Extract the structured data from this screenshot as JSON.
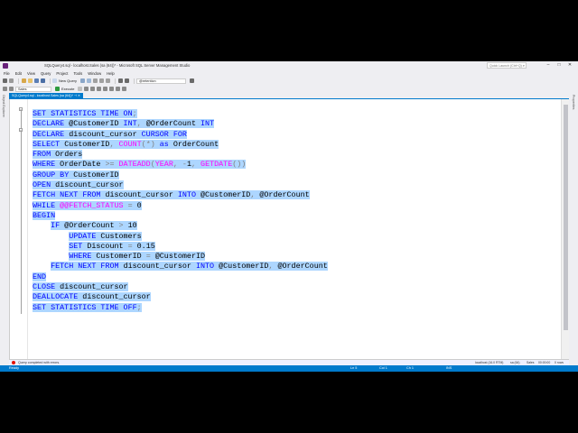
{
  "window": {
    "title": "SQLQuery4.sql - localhost.Sales (sa (64))* - Microsoft SQL Server Management Studio",
    "quick_launch_placeholder": "Quick Launch (Ctrl+Q)"
  },
  "menu": [
    "File",
    "Edit",
    "View",
    "Query",
    "Project",
    "Tools",
    "Window",
    "Help"
  ],
  "toolbar": {
    "new_query_label": "New Query",
    "database_value": "Sales",
    "execute_label": "Execute",
    "search_value": "@retention"
  },
  "side": {
    "left_label": "Object Explorer",
    "right_label": "Properties"
  },
  "tabs": [
    {
      "label": "SQLQuery4.sql - localhost.Sales (sa (64))*",
      "active": true
    }
  ],
  "code": [
    {
      "text": "SET STATISTICS TIME ON;"
    },
    {
      "text": "DECLARE @CustomerID INT, @OrderCount INT"
    },
    {
      "text": "DECLARE discount_cursor CURSOR FOR"
    },
    {
      "text": "SELECT CustomerID, COUNT(*) as OrderCount"
    },
    {
      "text": "FROM Orders"
    },
    {
      "text": "WHERE OrderDate >= DATEADD(YEAR, -1, GETDATE())"
    },
    {
      "text": "GROUP BY CustomerID"
    },
    {
      "text": "OPEN discount_cursor"
    },
    {
      "text": "FETCH NEXT FROM discount_cursor INTO @CustomerID, @OrderCount"
    },
    {
      "text": "WHILE @@FETCH_STATUS = 0"
    },
    {
      "text": "BEGIN"
    },
    {
      "text": "    IF @OrderCount > 10"
    },
    {
      "text": "        UPDATE Customers"
    },
    {
      "text": "        SET Discount = 0.15"
    },
    {
      "text": "        WHERE CustomerID = @CustomerID"
    },
    {
      "text": "    FETCH NEXT FROM discount_cursor INTO @CustomerID, @OrderCount"
    },
    {
      "text": "END"
    },
    {
      "text": "CLOSE discount_cursor"
    },
    {
      "text": "DEALLOCATE discount_cursor"
    },
    {
      "text": "SET STATISTICS TIME OFF;"
    }
  ],
  "editor": {
    "zoom": "100 %"
  },
  "query_status": {
    "message": "Query completed with errors.",
    "server": "localhost (16.0 RTM)",
    "user": "sa (64)",
    "database": "Sales",
    "time": "00:00:00",
    "rows": "0 rows"
  },
  "statusbar": {
    "ready": "Ready",
    "ln": "Ln 5",
    "col": "Col 1",
    "ch": "Ch 1",
    "ins": "INS"
  },
  "colors": {
    "accent": "#007acc",
    "selection": "#add6ff",
    "keyword": "#0000ff",
    "function": "#ff00ff"
  }
}
